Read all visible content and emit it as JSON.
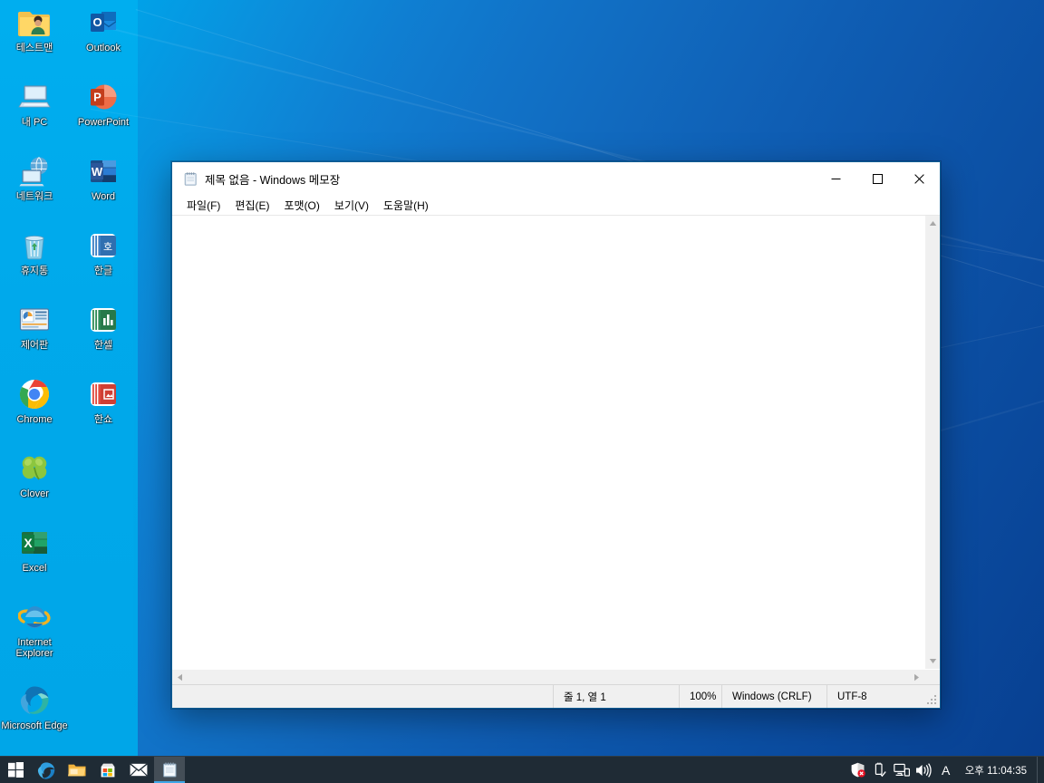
{
  "desktop": {
    "icons_left": [
      {
        "label": "테스트맨",
        "icon": "user-folder-icon"
      },
      {
        "label": "내 PC",
        "icon": "this-pc-icon"
      },
      {
        "label": "네트워크",
        "icon": "network-icon"
      },
      {
        "label": "휴지통",
        "icon": "recycle-bin-icon"
      },
      {
        "label": "제어판",
        "icon": "control-panel-icon"
      },
      {
        "label": "Chrome",
        "icon": "chrome-icon"
      },
      {
        "label": "Clover",
        "icon": "clover-icon"
      },
      {
        "label": "Excel",
        "icon": "excel-icon"
      },
      {
        "label": "Internet Explorer",
        "icon": "internet-explorer-icon"
      },
      {
        "label": "Microsoft Edge",
        "icon": "edge-icon"
      }
    ],
    "icons_right": [
      {
        "label": "Outlook",
        "icon": "outlook-icon"
      },
      {
        "label": "PowerPoint",
        "icon": "powerpoint-icon"
      },
      {
        "label": "Word",
        "icon": "word-icon"
      },
      {
        "label": "한글",
        "icon": "hangul-icon"
      },
      {
        "label": "한셀",
        "icon": "hancell-icon"
      },
      {
        "label": "한쇼",
        "icon": "hanshow-icon"
      }
    ]
  },
  "notepad": {
    "title": "제목 없음 - Windows 메모장",
    "title_icon": "notepad-icon",
    "window_buttons": {
      "minimize": "−",
      "maximize": "☐",
      "close": "✕"
    },
    "menu": [
      {
        "label": "파일(F)"
      },
      {
        "label": "편집(E)"
      },
      {
        "label": "포맷(O)"
      },
      {
        "label": "보기(V)"
      },
      {
        "label": "도움말(H)"
      }
    ],
    "content": "",
    "statusbar": {
      "blank": "",
      "line_col": "줄 1, 열 1",
      "zoom": "100%",
      "line_ending": "Windows (CRLF)",
      "encoding": "UTF-8"
    },
    "scrollbars": {
      "up": "⌃",
      "down": "⌄",
      "left": "‹",
      "right": "›"
    }
  },
  "taskbar": {
    "buttons": [
      {
        "name": "start-button",
        "icon": "windows-logo-icon"
      },
      {
        "name": "edge-legacy-button",
        "icon": "edge-legacy-icon"
      },
      {
        "name": "file-explorer-button",
        "icon": "file-explorer-icon"
      },
      {
        "name": "microsoft-store-button",
        "icon": "microsoft-store-icon"
      },
      {
        "name": "mail-button",
        "icon": "mail-icon"
      },
      {
        "name": "notepad-task-button",
        "icon": "notepad-icon",
        "active": true
      }
    ],
    "tray": [
      {
        "name": "security-icon",
        "icon": "shield-alert-icon"
      },
      {
        "name": "safely-remove-hardware-icon",
        "icon": "usb-eject-icon"
      },
      {
        "name": "network-icon",
        "icon": "network-monitor-icon"
      },
      {
        "name": "volume-icon",
        "icon": "speaker-icon"
      }
    ],
    "ime": "A",
    "clock": "오후 11:04:35"
  },
  "colors": {
    "accent": "#0078d7",
    "taskbar_bg": "#1f2b35",
    "wallpaper_band": "#00aeef",
    "active_underline": "#3ea7e8"
  }
}
